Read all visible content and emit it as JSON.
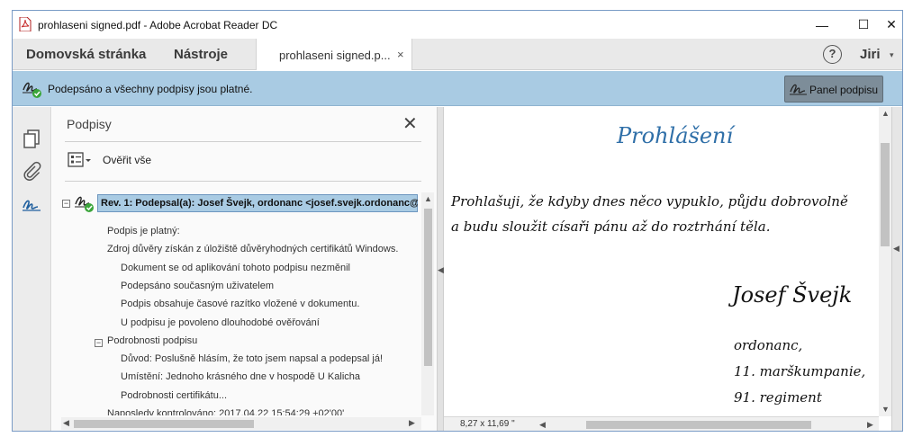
{
  "window": {
    "title": "prohlaseni signed.pdf - Adobe Acrobat Reader DC",
    "min_glyph": "—",
    "max_glyph": "☐",
    "close_glyph": "✕"
  },
  "menubar": {
    "home": "Domovská stránka",
    "tools": "Nástroje",
    "doc_tab": "prohlaseni signed.p...",
    "doc_tab_close": "×",
    "help": "?",
    "user": "Jiri",
    "user_caret": "▾"
  },
  "signature_bar": {
    "status": "Podepsáno a všechny podpisy jsou platné.",
    "panel_button": "Panel podpisu"
  },
  "signature_panel": {
    "title": "Podpisy",
    "close": "✕",
    "verify_all": "Ověřit vše",
    "revision_label": "Rev. 1: Podepsal(a): Josef Švejk, ordonanc <josef.svejk.ordonanc@",
    "lines": [
      "Podpis je platný:",
      "Zdroj důvěry získán z úložiště důvěryhodných certifikátů Windows.",
      "Dokument se od aplikování tohoto podpisu nezměnil",
      "Podepsáno současným uživatelem",
      "Podpis obsahuje časové razítko vložené v dokumentu.",
      "U podpisu je povoleno dlouhodobé ověřování",
      "Podrobnosti podpisu",
      "Důvod: Poslušně hlásím, že toto jsem napsal a podepsal já!",
      "Umístění: Jednoho krásného dne v hospodě U Kalicha",
      "Podrobnosti certifikátu...",
      "Naposledy kontrolováno: 2017.04.22 15:54:29 +02'00'"
    ]
  },
  "document": {
    "title": "Prohlášení",
    "body": [
      "Prohlašuji, že kdyby dnes něco vypuklo, půjdu dobrovolně",
      "a budu sloužit císaři pánu až do roztrhání těla."
    ],
    "signer_name": "Josef Švejk",
    "signer_lines": [
      "ordonanc,",
      "11. marškumpanie,",
      "91. regiment"
    ],
    "page_size": "8,27 x 11,69 \""
  },
  "colors": {
    "accent_blue": "#2f6fa8",
    "banner_blue": "#a9cbe3",
    "valid_green": "#3aa53a"
  },
  "icons": [
    "pdf-file-icon",
    "signature-valid-icon",
    "pages-icon",
    "attachment-icon",
    "signature-icon",
    "verify-list-icon"
  ]
}
